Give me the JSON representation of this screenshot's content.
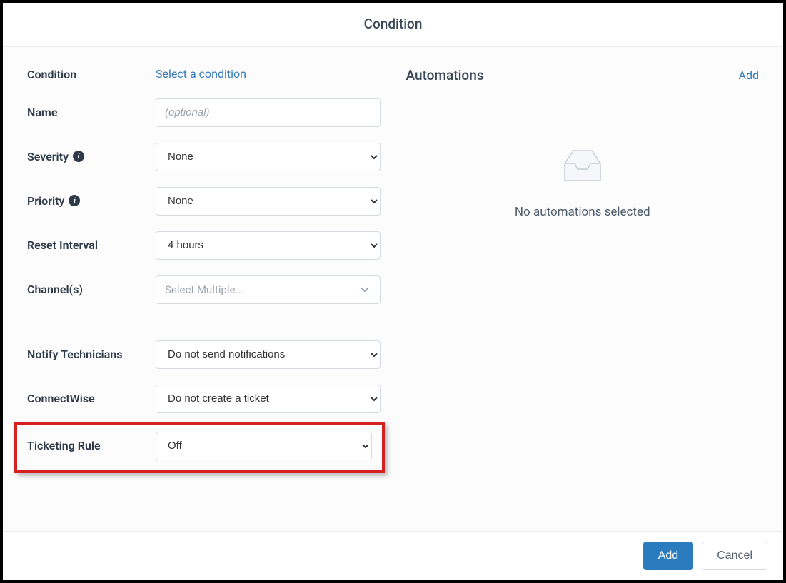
{
  "title": "Condition",
  "left": {
    "condition": {
      "label": "Condition",
      "linkText": "Select a condition"
    },
    "name": {
      "label": "Name",
      "placeholder": "(optional)",
      "value": ""
    },
    "severity": {
      "label": "Severity",
      "value": "None"
    },
    "priority": {
      "label": "Priority",
      "value": "None"
    },
    "resetInterval": {
      "label": "Reset Interval",
      "value": "4 hours"
    },
    "channels": {
      "label": "Channel(s)",
      "placeholder": "Select Multiple..."
    },
    "notify": {
      "label": "Notify Technicians",
      "value": "Do not send notifications"
    },
    "connectwise": {
      "label": "ConnectWise",
      "value": "Do not create a ticket"
    },
    "ticketing": {
      "label": "Ticketing Rule",
      "value": "Off"
    }
  },
  "right": {
    "title": "Automations",
    "addLink": "Add",
    "emptyText": "No automations selected"
  },
  "footer": {
    "add": "Add",
    "cancel": "Cancel"
  }
}
